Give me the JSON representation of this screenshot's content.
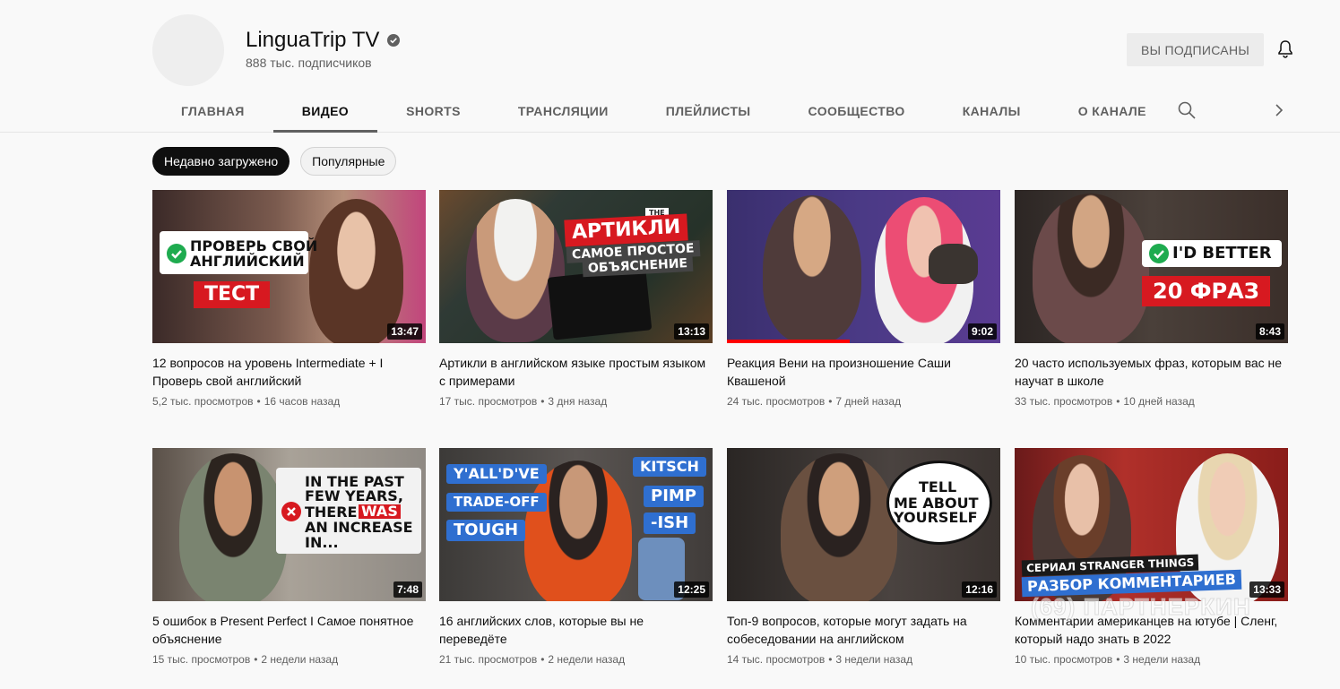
{
  "channel": {
    "name": "LinguaTrip TV",
    "subscribers": "888 тыс. подписчиков",
    "subscribe_label": "ВЫ ПОДПИСАНЫ"
  },
  "tabs": [
    {
      "label": "ГЛАВНАЯ"
    },
    {
      "label": "ВИДЕО"
    },
    {
      "label": "SHORTS"
    },
    {
      "label": "ТРАНСЛЯЦИИ"
    },
    {
      "label": "ПЛЕЙЛИСТЫ"
    },
    {
      "label": "СООБЩЕСТВО"
    },
    {
      "label": "КАНАЛЫ"
    },
    {
      "label": "О КАНАЛЕ"
    }
  ],
  "active_tab": "ВИДЕО",
  "chips": [
    {
      "label": "Недавно загружено"
    },
    {
      "label": "Популярные"
    }
  ],
  "icons": {
    "verified": "verified-check-icon",
    "bell": "bell-icon",
    "search": "search-icon",
    "next": "chevron-right-icon"
  },
  "colors": {
    "accent_red": "#ff0000",
    "chip_active_bg": "#0f0f0f",
    "sub_button_bg": "#ececec"
  },
  "videos": [
    {
      "title": "12 вопросов на уровень Intermediate + I Проверь свой английский",
      "views": "5,2 тыс. просмотров",
      "age": "16 часов назад",
      "duration": "13:47",
      "thumb_text": [
        "ПРОВЕРЬ СВОЙ",
        "АНГЛИЙСКИЙ",
        "ТЕСТ"
      ]
    },
    {
      "title": "Артикли в английском языке простым языком с примерами",
      "views": "17 тыс. просмотров",
      "age": "3 дня назад",
      "duration": "13:13",
      "thumb_text": [
        "THE",
        "АРТИКЛИ",
        "САМОЕ ПРОСТОЕ",
        "ОБЪЯСНЕНИЕ"
      ]
    },
    {
      "title": "Реакция Вени на произношение Саши Квашеной",
      "views": "24 тыс. просмотров",
      "age": "7 дней назад",
      "duration": "9:02",
      "watched_fraction": 0.45
    },
    {
      "title": "20 часто используемых фраз, которым вас не научат в школе",
      "views": "33 тыс. просмотров",
      "age": "10 дней назад",
      "duration": "8:43",
      "thumb_text": [
        "I'D BETTER",
        "20 ФРАЗ"
      ]
    },
    {
      "title": "5 ошибок в Present Perfect I Самое понятное объяснение",
      "views": "15 тыс. просмотров",
      "age": "2 недели назад",
      "duration": "7:48",
      "thumb_text": [
        "IN THE PAST",
        "FEW YEARS,",
        "THERE",
        "WAS",
        "AN INCREASE",
        "IN..."
      ]
    },
    {
      "title": "16 английских слов, которые вы не переведёте",
      "views": "21 тыс. просмотров",
      "age": "2 недели назад",
      "duration": "12:25",
      "thumb_text": [
        "Y'ALL'D'VE",
        "TRADE-OFF",
        "TOUGH",
        "KITSCH",
        "PIMP",
        "-ISH"
      ]
    },
    {
      "title": "Топ-9 вопросов, которые могут задать на собеседовании на английском",
      "views": "14 тыс. просмотров",
      "age": "3 недели назад",
      "duration": "12:16",
      "thumb_text": [
        "TELL",
        "ME ABOUT",
        "YOURSELF"
      ]
    },
    {
      "title": "Комментарии американцев на ютубе | Сленг, который надо знать в 2022",
      "views": "10 тыс. просмотров",
      "age": "3 недели назад",
      "duration": "13:33",
      "thumb_text": [
        "СЕРИАЛ STRANGER THINGS",
        "РАЗБОР КОММЕНТАРИЕВ"
      ]
    }
  ],
  "watermark": "(69) ПАРТНЕРКИН"
}
